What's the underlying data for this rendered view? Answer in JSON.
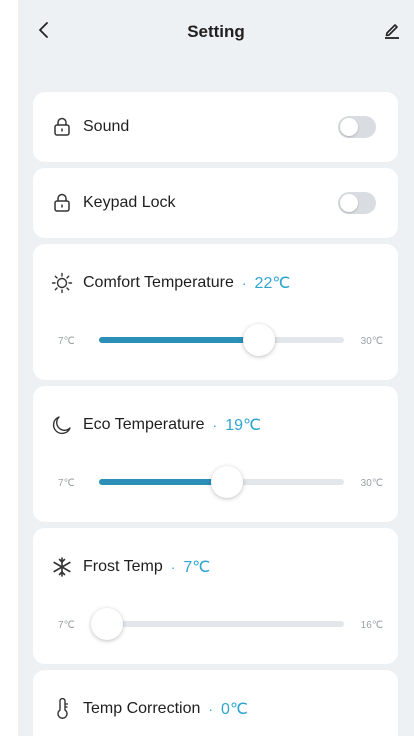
{
  "header": {
    "title": "Setting",
    "back_icon": "chevron-left-icon",
    "edit_icon": "pencil-icon"
  },
  "colors": {
    "accent": "#2ea6d0",
    "slider_fill": "#2b8fb8",
    "background": "#eef1f4"
  },
  "sound": {
    "label": "Sound",
    "icon": "lock-icon",
    "enabled": false
  },
  "keypad_lock": {
    "label": "Keypad Lock",
    "icon": "lock-icon",
    "enabled": false
  },
  "comfort": {
    "label": "Comfort Temperature",
    "separator": "·",
    "value": "22℃",
    "min": "7℃",
    "max": "30℃",
    "icon": "sun-icon",
    "current": 22,
    "range": [
      7,
      30
    ]
  },
  "eco": {
    "label": "Eco Temperature",
    "separator": "·",
    "value": "19℃",
    "min": "7℃",
    "max": "30℃",
    "icon": "moon-icon",
    "current": 19,
    "range": [
      7,
      30
    ]
  },
  "frost": {
    "label": "Frost Temp",
    "separator": "·",
    "value": "7℃",
    "min": "7℃",
    "max": "16℃",
    "icon": "snowflake-icon",
    "current": 7,
    "range": [
      7,
      16
    ]
  },
  "correction": {
    "label": "Temp Correction",
    "separator": "·",
    "value": "0℃",
    "icon": "thermometer-icon"
  }
}
